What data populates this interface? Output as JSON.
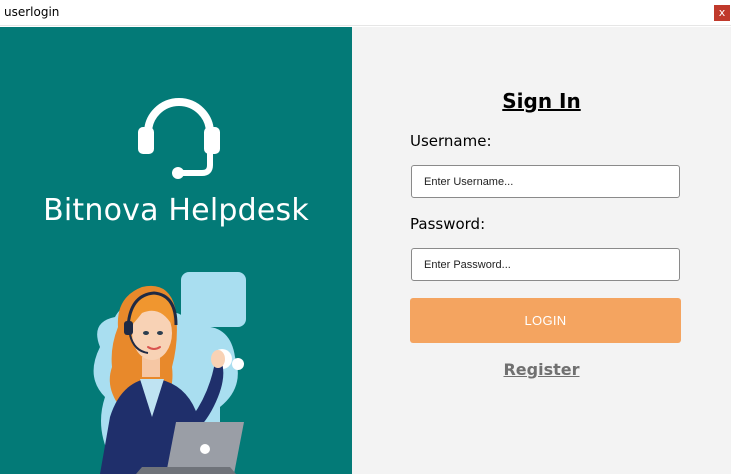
{
  "window": {
    "title": "userlogin",
    "close_glyph": "x"
  },
  "brand": {
    "name": "Bitnova Helpdesk",
    "icon": "headset-icon",
    "panel_color": "#037a77"
  },
  "form": {
    "heading": "Sign In",
    "username_label": "Username:",
    "username_placeholder": "Enter Username...",
    "username_value": "",
    "password_label": "Password:",
    "password_placeholder": "Enter Password...",
    "password_value": "",
    "login_label": "LOGIN",
    "login_color": "#f4a460",
    "register_label": "Register"
  }
}
